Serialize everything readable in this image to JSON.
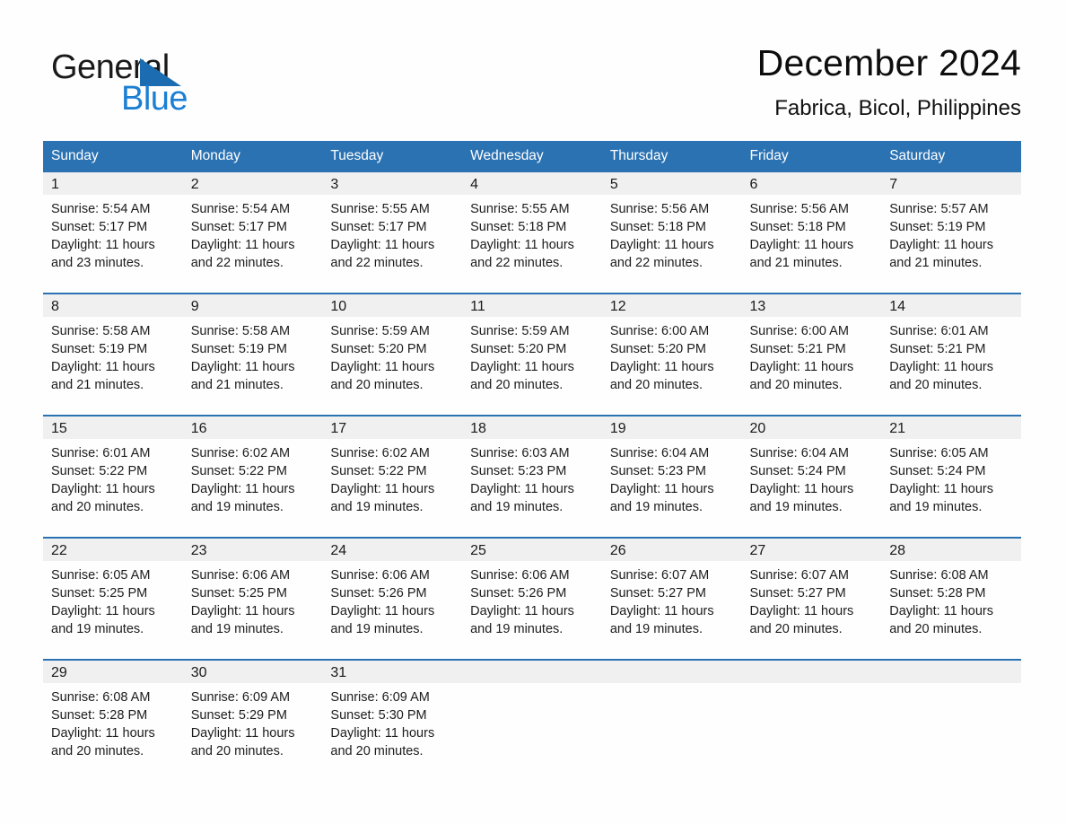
{
  "brand": {
    "name_part1": "General",
    "name_part2": "Blue",
    "logo_icon": "triangle-flag-icon"
  },
  "header": {
    "title": "December 2024",
    "subtitle": "Fabrica, Bicol, Philippines"
  },
  "colors": {
    "header_blue": "#2b72b3",
    "brand_blue": "#1b7fd4",
    "daynum_band": "#f0f0f0",
    "text": "#1c1c1c"
  },
  "weekday_headers": [
    "Sunday",
    "Monday",
    "Tuesday",
    "Wednesday",
    "Thursday",
    "Friday",
    "Saturday"
  ],
  "weeks": [
    [
      {
        "day": "1",
        "sunrise": "Sunrise: 5:54 AM",
        "sunset": "Sunset: 5:17 PM",
        "daylight": "Daylight: 11 hours and 23 minutes."
      },
      {
        "day": "2",
        "sunrise": "Sunrise: 5:54 AM",
        "sunset": "Sunset: 5:17 PM",
        "daylight": "Daylight: 11 hours and 22 minutes."
      },
      {
        "day": "3",
        "sunrise": "Sunrise: 5:55 AM",
        "sunset": "Sunset: 5:17 PM",
        "daylight": "Daylight: 11 hours and 22 minutes."
      },
      {
        "day": "4",
        "sunrise": "Sunrise: 5:55 AM",
        "sunset": "Sunset: 5:18 PM",
        "daylight": "Daylight: 11 hours and 22 minutes."
      },
      {
        "day": "5",
        "sunrise": "Sunrise: 5:56 AM",
        "sunset": "Sunset: 5:18 PM",
        "daylight": "Daylight: 11 hours and 22 minutes."
      },
      {
        "day": "6",
        "sunrise": "Sunrise: 5:56 AM",
        "sunset": "Sunset: 5:18 PM",
        "daylight": "Daylight: 11 hours and 21 minutes."
      },
      {
        "day": "7",
        "sunrise": "Sunrise: 5:57 AM",
        "sunset": "Sunset: 5:19 PM",
        "daylight": "Daylight: 11 hours and 21 minutes."
      }
    ],
    [
      {
        "day": "8",
        "sunrise": "Sunrise: 5:58 AM",
        "sunset": "Sunset: 5:19 PM",
        "daylight": "Daylight: 11 hours and 21 minutes."
      },
      {
        "day": "9",
        "sunrise": "Sunrise: 5:58 AM",
        "sunset": "Sunset: 5:19 PM",
        "daylight": "Daylight: 11 hours and 21 minutes."
      },
      {
        "day": "10",
        "sunrise": "Sunrise: 5:59 AM",
        "sunset": "Sunset: 5:20 PM",
        "daylight": "Daylight: 11 hours and 20 minutes."
      },
      {
        "day": "11",
        "sunrise": "Sunrise: 5:59 AM",
        "sunset": "Sunset: 5:20 PM",
        "daylight": "Daylight: 11 hours and 20 minutes."
      },
      {
        "day": "12",
        "sunrise": "Sunrise: 6:00 AM",
        "sunset": "Sunset: 5:20 PM",
        "daylight": "Daylight: 11 hours and 20 minutes."
      },
      {
        "day": "13",
        "sunrise": "Sunrise: 6:00 AM",
        "sunset": "Sunset: 5:21 PM",
        "daylight": "Daylight: 11 hours and 20 minutes."
      },
      {
        "day": "14",
        "sunrise": "Sunrise: 6:01 AM",
        "sunset": "Sunset: 5:21 PM",
        "daylight": "Daylight: 11 hours and 20 minutes."
      }
    ],
    [
      {
        "day": "15",
        "sunrise": "Sunrise: 6:01 AM",
        "sunset": "Sunset: 5:22 PM",
        "daylight": "Daylight: 11 hours and 20 minutes."
      },
      {
        "day": "16",
        "sunrise": "Sunrise: 6:02 AM",
        "sunset": "Sunset: 5:22 PM",
        "daylight": "Daylight: 11 hours and 19 minutes."
      },
      {
        "day": "17",
        "sunrise": "Sunrise: 6:02 AM",
        "sunset": "Sunset: 5:22 PM",
        "daylight": "Daylight: 11 hours and 19 minutes."
      },
      {
        "day": "18",
        "sunrise": "Sunrise: 6:03 AM",
        "sunset": "Sunset: 5:23 PM",
        "daylight": "Daylight: 11 hours and 19 minutes."
      },
      {
        "day": "19",
        "sunrise": "Sunrise: 6:04 AM",
        "sunset": "Sunset: 5:23 PM",
        "daylight": "Daylight: 11 hours and 19 minutes."
      },
      {
        "day": "20",
        "sunrise": "Sunrise: 6:04 AM",
        "sunset": "Sunset: 5:24 PM",
        "daylight": "Daylight: 11 hours and 19 minutes."
      },
      {
        "day": "21",
        "sunrise": "Sunrise: 6:05 AM",
        "sunset": "Sunset: 5:24 PM",
        "daylight": "Daylight: 11 hours and 19 minutes."
      }
    ],
    [
      {
        "day": "22",
        "sunrise": "Sunrise: 6:05 AM",
        "sunset": "Sunset: 5:25 PM",
        "daylight": "Daylight: 11 hours and 19 minutes."
      },
      {
        "day": "23",
        "sunrise": "Sunrise: 6:06 AM",
        "sunset": "Sunset: 5:25 PM",
        "daylight": "Daylight: 11 hours and 19 minutes."
      },
      {
        "day": "24",
        "sunrise": "Sunrise: 6:06 AM",
        "sunset": "Sunset: 5:26 PM",
        "daylight": "Daylight: 11 hours and 19 minutes."
      },
      {
        "day": "25",
        "sunrise": "Sunrise: 6:06 AM",
        "sunset": "Sunset: 5:26 PM",
        "daylight": "Daylight: 11 hours and 19 minutes."
      },
      {
        "day": "26",
        "sunrise": "Sunrise: 6:07 AM",
        "sunset": "Sunset: 5:27 PM",
        "daylight": "Daylight: 11 hours and 19 minutes."
      },
      {
        "day": "27",
        "sunrise": "Sunrise: 6:07 AM",
        "sunset": "Sunset: 5:27 PM",
        "daylight": "Daylight: 11 hours and 20 minutes."
      },
      {
        "day": "28",
        "sunrise": "Sunrise: 6:08 AM",
        "sunset": "Sunset: 5:28 PM",
        "daylight": "Daylight: 11 hours and 20 minutes."
      }
    ],
    [
      {
        "day": "29",
        "sunrise": "Sunrise: 6:08 AM",
        "sunset": "Sunset: 5:28 PM",
        "daylight": "Daylight: 11 hours and 20 minutes."
      },
      {
        "day": "30",
        "sunrise": "Sunrise: 6:09 AM",
        "sunset": "Sunset: 5:29 PM",
        "daylight": "Daylight: 11 hours and 20 minutes."
      },
      {
        "day": "31",
        "sunrise": "Sunrise: 6:09 AM",
        "sunset": "Sunset: 5:30 PM",
        "daylight": "Daylight: 11 hours and 20 minutes."
      },
      {
        "day": "",
        "sunrise": "",
        "sunset": "",
        "daylight": ""
      },
      {
        "day": "",
        "sunrise": "",
        "sunset": "",
        "daylight": ""
      },
      {
        "day": "",
        "sunrise": "",
        "sunset": "",
        "daylight": ""
      },
      {
        "day": "",
        "sunrise": "",
        "sunset": "",
        "daylight": ""
      }
    ]
  ]
}
